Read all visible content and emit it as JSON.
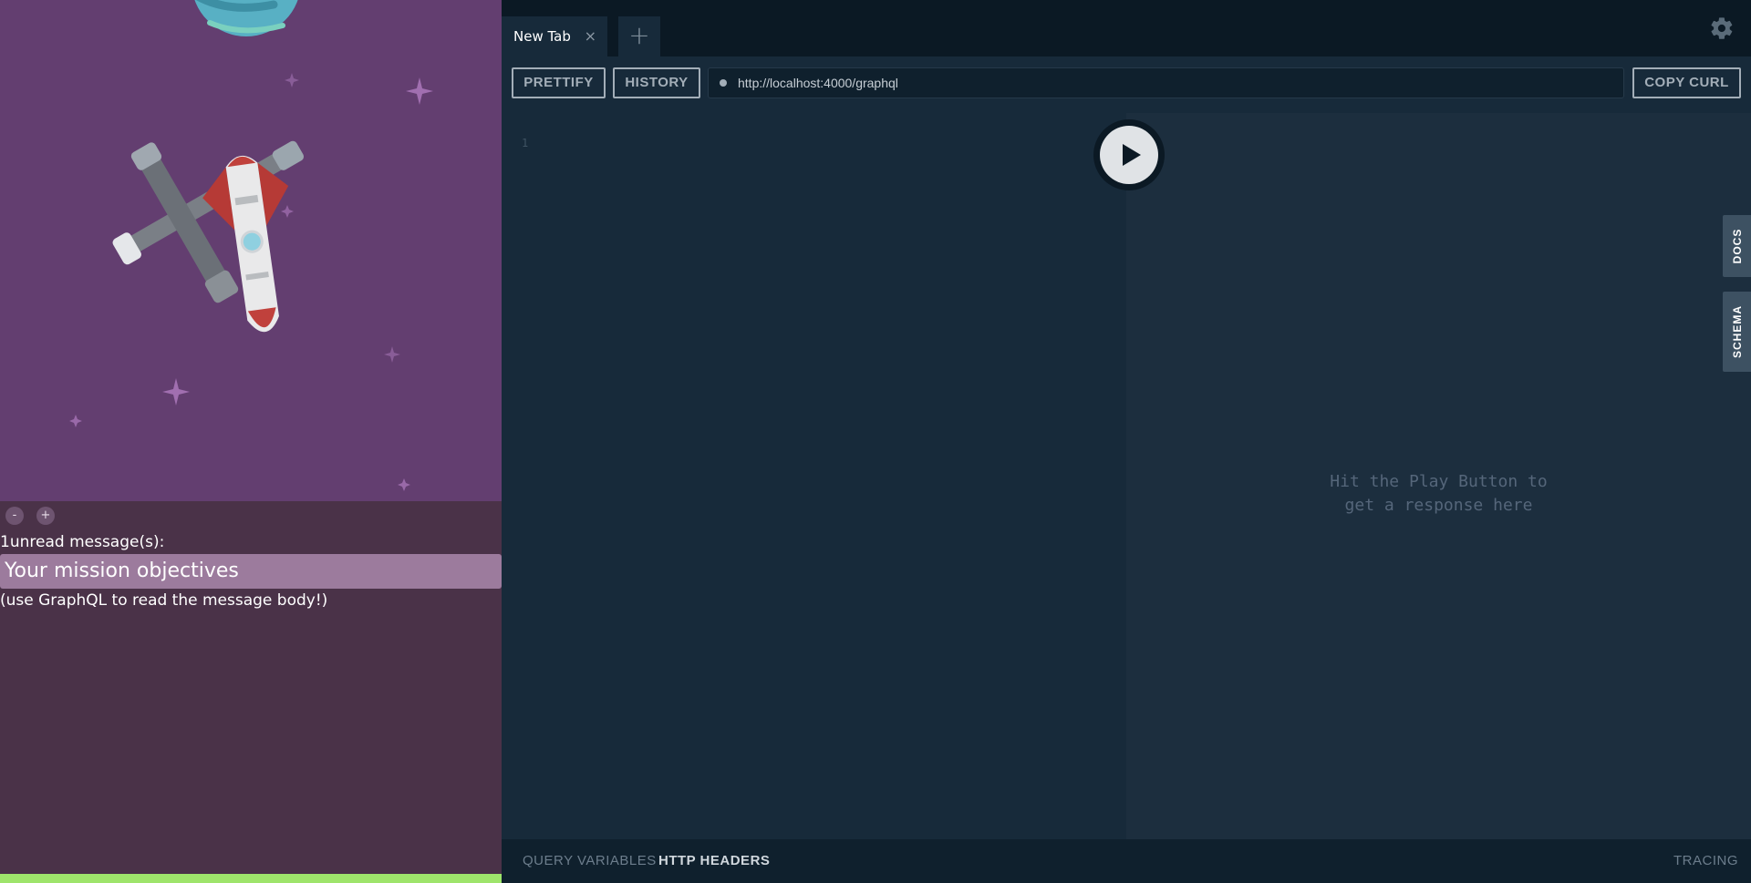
{
  "game": {
    "zoom_out_label": "-",
    "zoom_in_label": "+",
    "unread_count": "1",
    "unread_label": "unread message(s):",
    "message_title": "Your mission objectives",
    "hint": "(use GraphQL to read the message body!)",
    "progress": 1.0
  },
  "playground": {
    "tab_label": "New Tab",
    "tab_close": "×",
    "add_tab": "+",
    "prettify": "PRETTIFY",
    "history": "HISTORY",
    "endpoint": "http://localhost:4000/graphql",
    "copy_curl": "COPY CURL",
    "line_number": "1",
    "result_hint_line1": "Hit the Play Button to",
    "result_hint_line2": "get a response here",
    "docs": "DOCS",
    "schema": "SCHEMA",
    "query_variables": "QUERY VARIABLES",
    "http_headers": "HTTP HEADERS",
    "tracing": "TRACING"
  },
  "colors": {
    "space_bg": "#633e70",
    "panel_bg": "#4a3248",
    "message_bg": "#9c7b9d",
    "progress": "#9ee46b",
    "editor_bg": "#172a3a",
    "result_bg": "#1c2e3e"
  },
  "icons": [
    "planet-icon",
    "rocket-icon",
    "satellite-icon",
    "gear-icon",
    "play-icon",
    "close-icon",
    "plus-icon"
  ]
}
